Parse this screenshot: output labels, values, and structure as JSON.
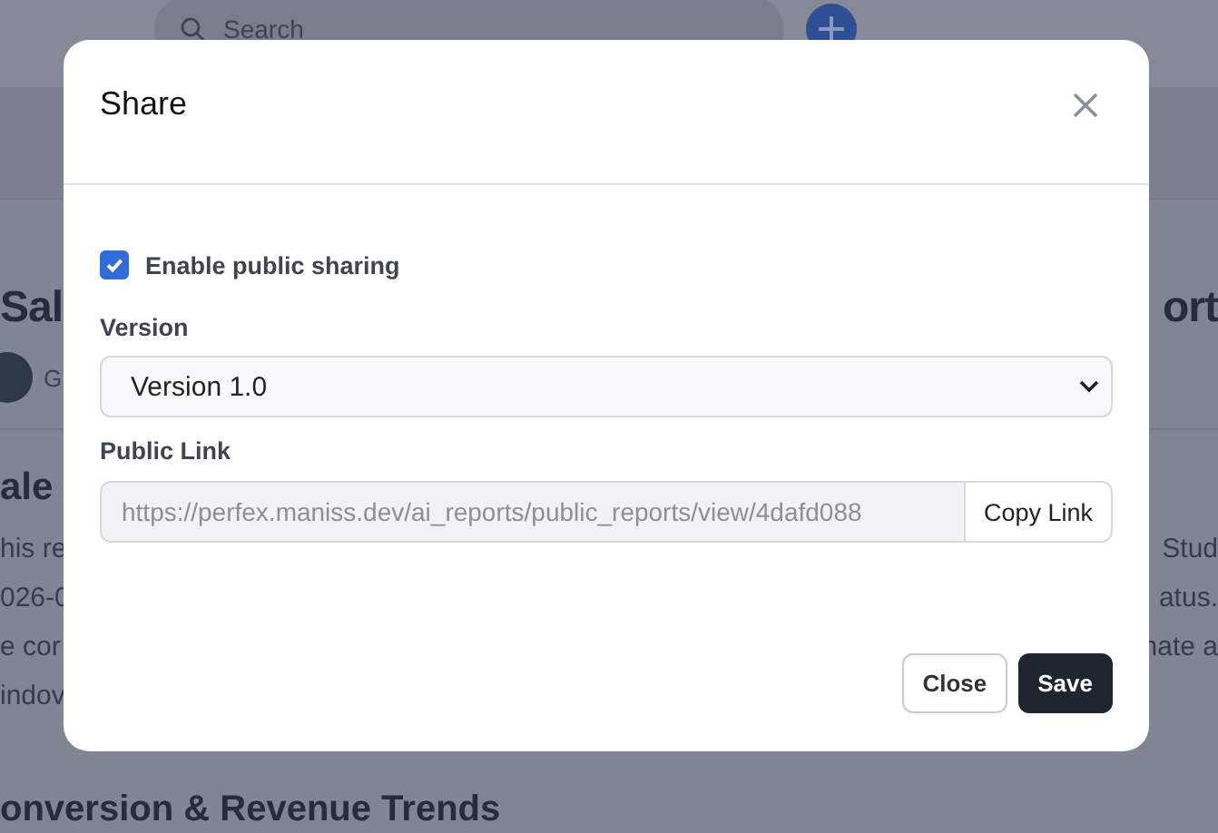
{
  "header": {
    "search": {
      "placeholder": "Search"
    }
  },
  "page": {
    "title": {
      "left": "Sal",
      "right": "ort"
    },
    "author": {
      "initial": "G"
    },
    "section_heading": "ale",
    "paragraph_lines": [
      {
        "left": "his re",
        "right": "Stud"
      },
      {
        "left": "026-0",
        "right": "atus."
      },
      {
        "left": "e cor",
        "right": "nate a"
      },
      {
        "left": "indov"
      }
    ],
    "next_heading": "onversion & Revenue Trends"
  },
  "dialog": {
    "title": "Share",
    "sharing": {
      "label": "Enable public sharing",
      "checked": true
    },
    "version": {
      "label": "Version",
      "value": "Version 1.0"
    },
    "public_link": {
      "label": "Public Link",
      "value": "https://perfex.maniss.dev/ai_reports/public_reports/view/4dafd088",
      "button": "Copy Link"
    },
    "buttons": [
      {
        "label": "Close",
        "kind": "secondary"
      },
      {
        "label": "Save",
        "kind": "primary"
      }
    ]
  }
}
